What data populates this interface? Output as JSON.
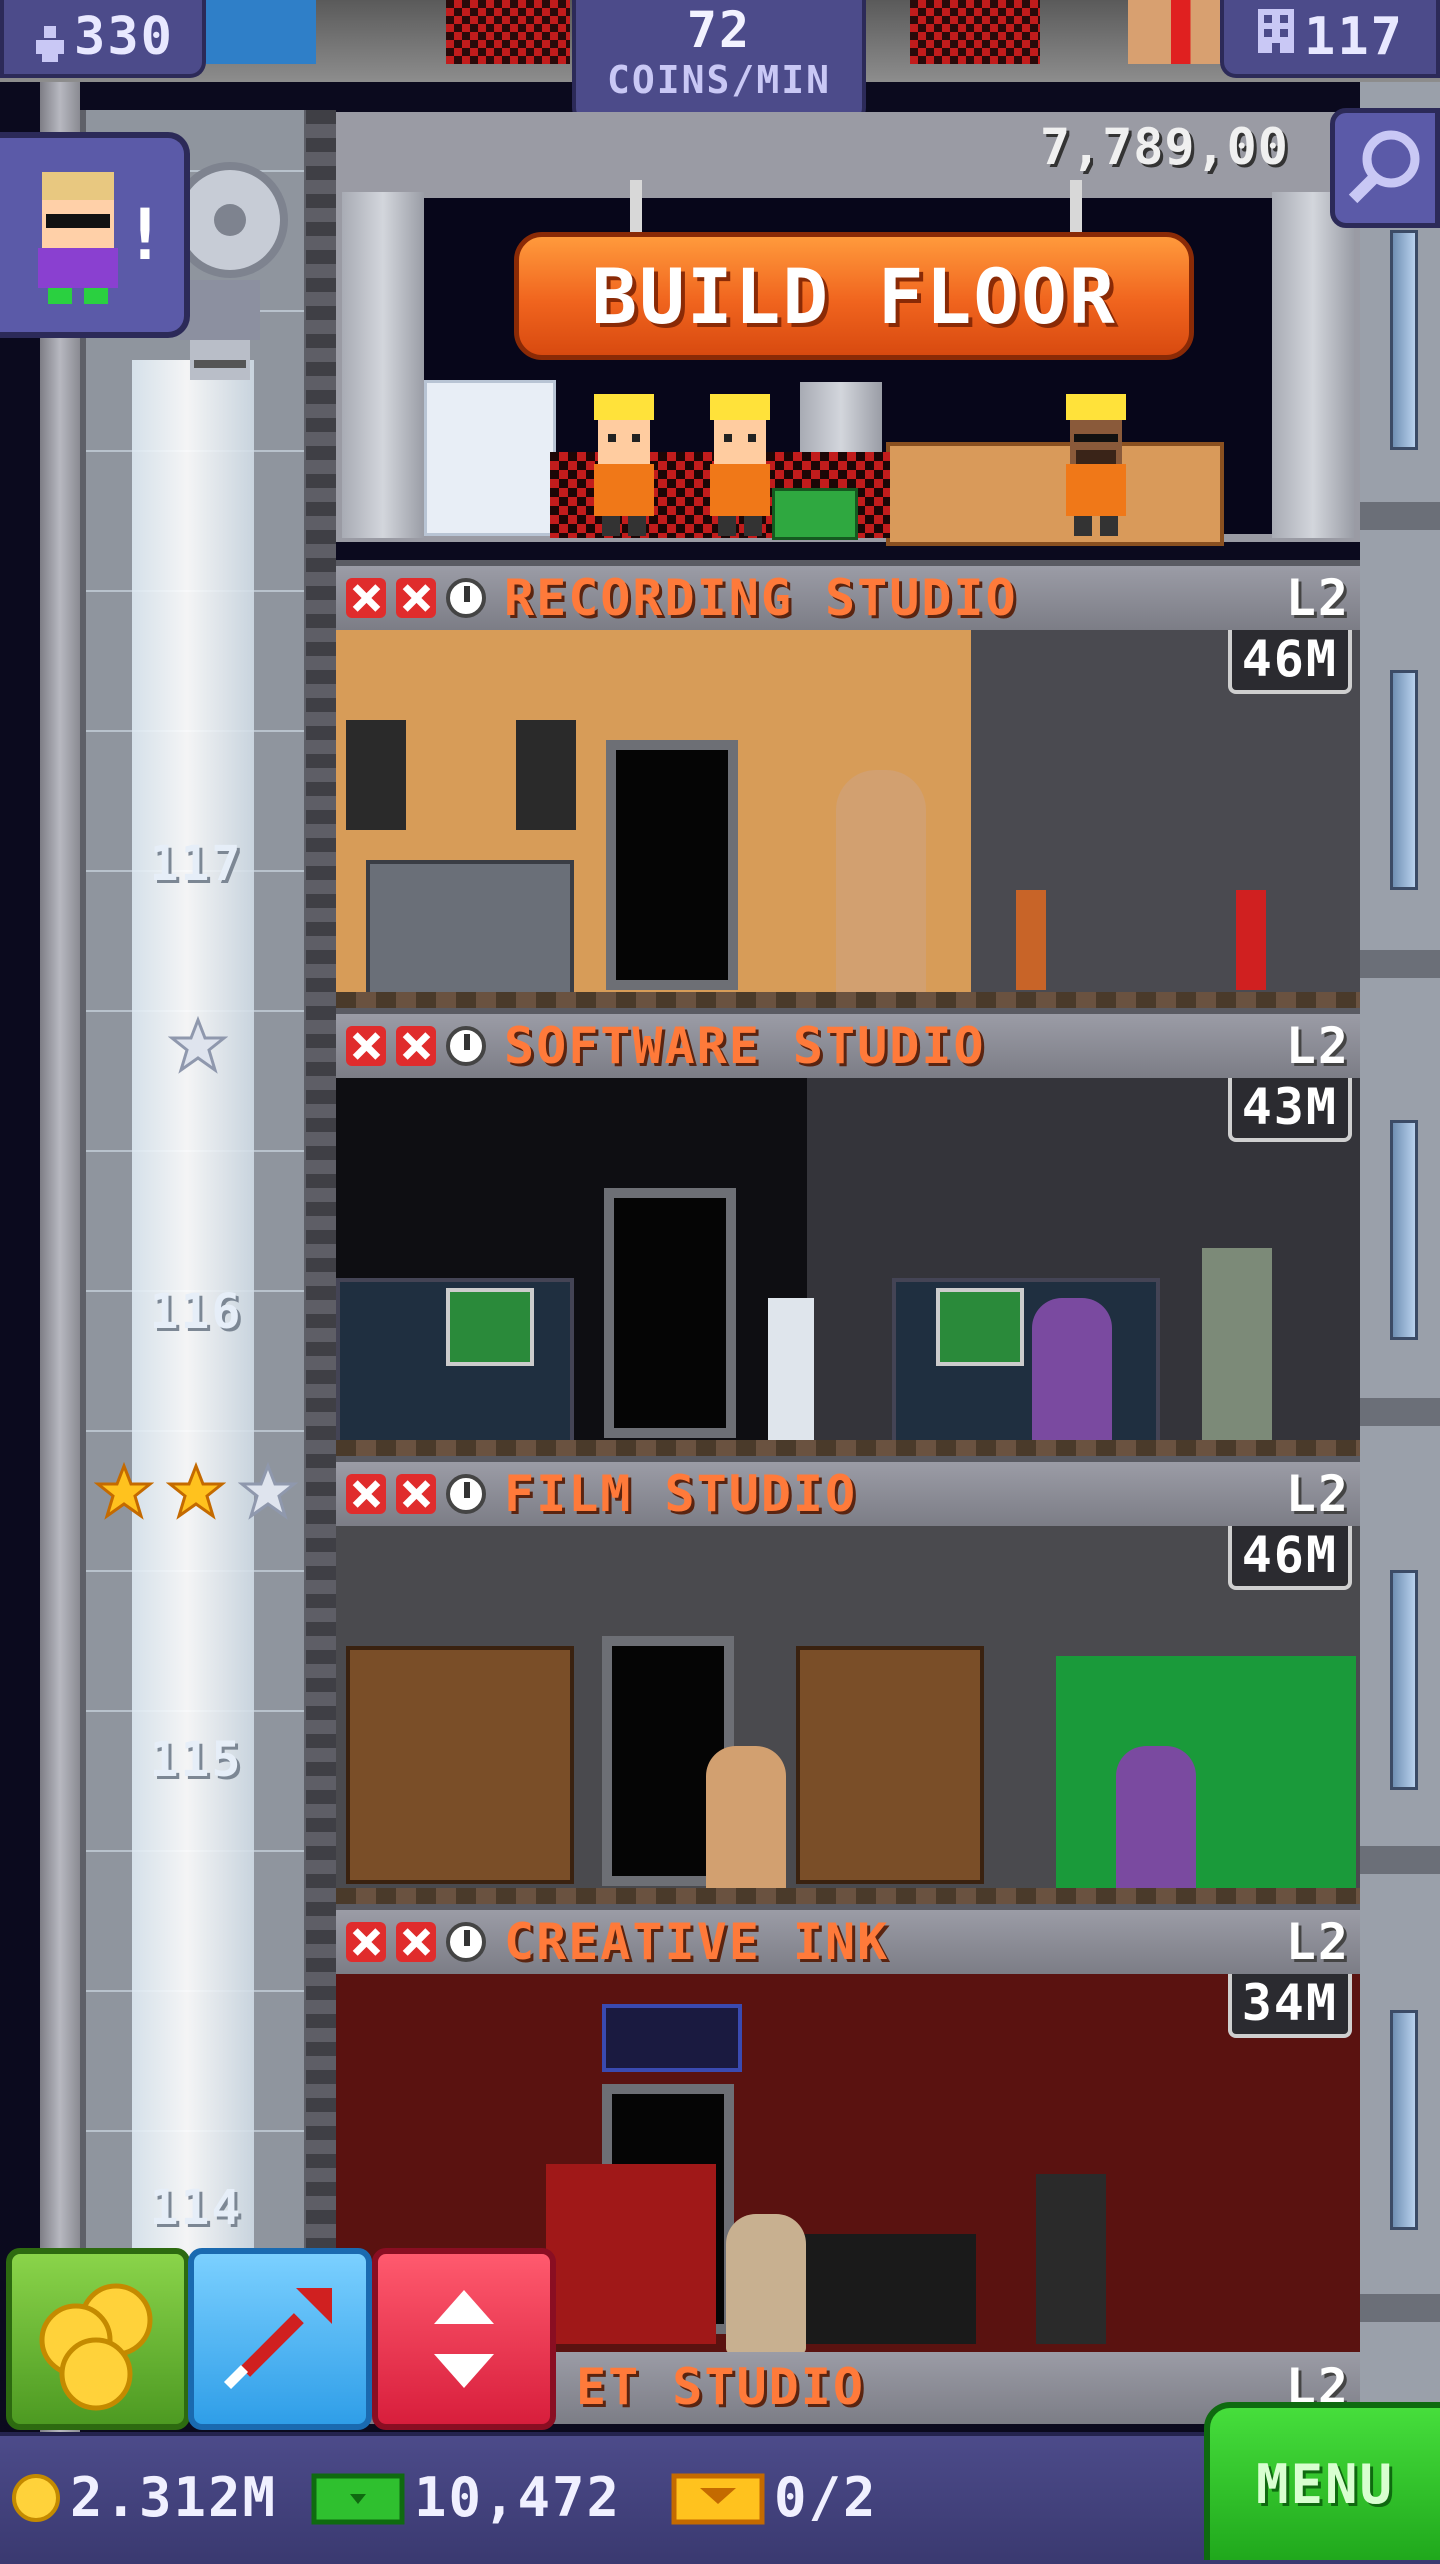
{
  "hud": {
    "population": "330",
    "coins_rate_value": "72",
    "coins_rate_unit": "COINS/MIN",
    "floor_count": "117"
  },
  "build": {
    "balance": "7,789,00",
    "button_label": "BUILD FLOOR"
  },
  "elevator": {
    "floor_numbers": [
      "117",
      "116",
      "115",
      "114"
    ]
  },
  "floors": [
    {
      "name": "RECORDING STUDIO",
      "level": "L2",
      "income": "46M"
    },
    {
      "name": "SOFTWARE STUDIO",
      "level": "L2",
      "income": "43M"
    },
    {
      "name": "FILM STUDIO",
      "level": "L2",
      "income": "46M"
    },
    {
      "name": "CREATIVE INK",
      "level": "L2",
      "income": "34M"
    }
  ],
  "next_floor": {
    "name": "ET STUDIO",
    "level": "L2"
  },
  "resources": {
    "coins": "2.312M",
    "bux": "10,472",
    "tickets": "0/2"
  },
  "menu_label": "MENU",
  "colors": {
    "hud_purple": "#4c4b8a",
    "build_orange": "#f0641e",
    "floor_name_orange": "#ff7a3a",
    "menu_green": "#20a81c",
    "coins_green": "#4d9a22",
    "move_blue": "#2f9ee8",
    "elevator_red": "#d81e3c"
  },
  "icons": {
    "population": "person-icon",
    "floors": "building-icon",
    "search": "magnifier-icon",
    "status_missing": "red-x-icon",
    "status_timer": "clock-icon",
    "coins": "coin-icon",
    "bux": "banknote-icon",
    "tickets": "ticket-icon",
    "star_gold": "gold-star-icon",
    "star_silver": "silver-star-icon"
  }
}
